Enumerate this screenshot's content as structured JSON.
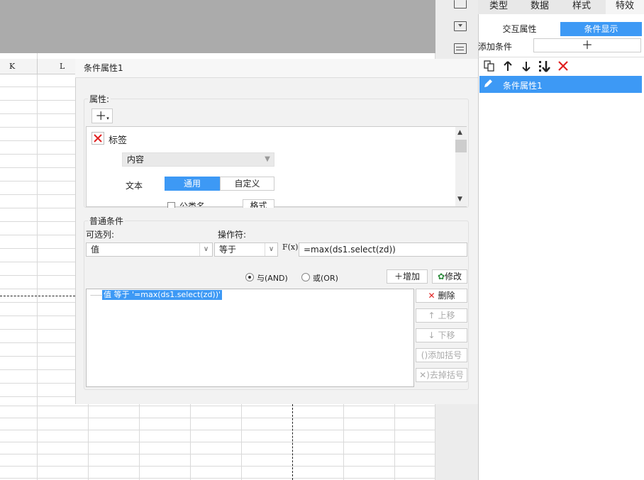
{
  "sheet": {
    "col_k": "K",
    "col_l": "L"
  },
  "right_panel": {
    "tabs": [
      "类型",
      "数据",
      "样式",
      "特效"
    ],
    "subtabs": [
      "交互属性",
      "条件显示"
    ],
    "add_condition_label": "添加条件",
    "add_icon": "plus-icon",
    "toolbar_icons": [
      "copy-icon",
      "arrow-up-icon",
      "arrow-down-icon",
      "sort-down-icon",
      "delete-icon"
    ],
    "items": [
      {
        "label": "条件属性1",
        "icon": "edit-pencil-icon"
      }
    ]
  },
  "dialog": {
    "title": "条件属性1",
    "attributes": {
      "legend": "属性:",
      "add_icon": "plus-dropdown-icon",
      "item_label": "标签",
      "content_label": "内容",
      "text_label": "文本",
      "text_modes": [
        "通用",
        "自定义"
      ],
      "partial_checkbox": "公类名",
      "partial_button": "格式"
    },
    "conditions": {
      "legend": "普通条件",
      "column_label": "可选列:",
      "column_value": "值",
      "operator_label": "操作符:",
      "operator_value": "等于",
      "fx_label": "F(x)",
      "formula_value": "=max(ds1.select(zd))",
      "logic_and": "与(AND)",
      "logic_or": "或(OR)",
      "add_button": "增加",
      "modify_button": "修改",
      "condition_item": "值 等于 '=max(ds1.select(zd))'",
      "side_buttons": {
        "delete": "删除",
        "move_up": "上移",
        "move_down": "下移",
        "add_bracket": "添加括号",
        "remove_bracket": "去掉括号"
      }
    }
  },
  "colors": {
    "accent": "#3d99f5",
    "delete_red": "#e02020"
  }
}
